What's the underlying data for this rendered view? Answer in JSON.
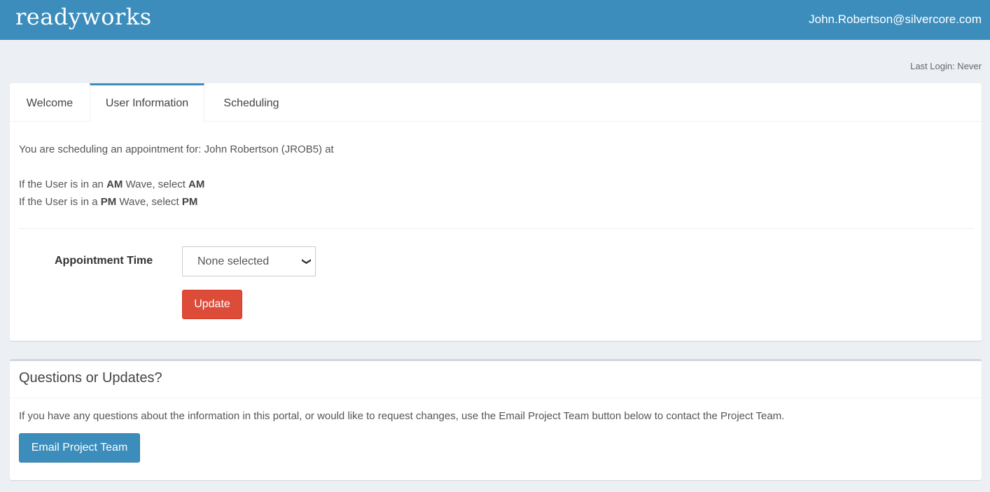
{
  "header": {
    "logo_text": "readyworks",
    "user_email": "John.Robertson@silvercore.com"
  },
  "last_login": "Last Login: Never",
  "tabs": [
    {
      "label": "Welcome"
    },
    {
      "label": "User Information"
    },
    {
      "label": "Scheduling"
    }
  ],
  "main": {
    "scheduling_text": "You are scheduling an appointment for: John Robertson (JROB5) at",
    "am_line": {
      "prefix": "If the User is in an ",
      "bold1": "AM",
      "middle": " Wave, select ",
      "bold2": "AM"
    },
    "pm_line": {
      "prefix": "If the User is in a ",
      "bold1": "PM",
      "middle": " Wave, select ",
      "bold2": "PM"
    },
    "appointment_label": "Appointment Time",
    "appointment_value": "None selected",
    "update_label": "Update"
  },
  "questions": {
    "title": "Questions or Updates?",
    "text": "If you have any questions about the information in this portal, or would like to request changes, use the Email Project Team button below to contact the Project Team.",
    "email_button": "Email Project Team"
  },
  "colors": {
    "header_bg": "#3c8dbc",
    "update_button": "#dd4b39",
    "email_button": "#3c8dbc"
  }
}
